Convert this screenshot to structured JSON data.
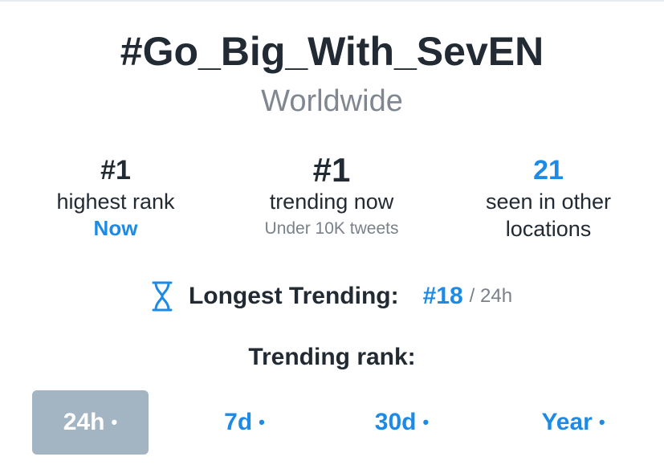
{
  "hashtag": "#Go_Big_With_SevEN",
  "location": "Worldwide",
  "stats": {
    "highest": {
      "value": "#1",
      "label": "highest rank",
      "sub": "Now"
    },
    "now": {
      "value": "#1",
      "label": "trending now",
      "sub": "Under 10K tweets"
    },
    "other": {
      "value": "21",
      "label1": "seen in other",
      "label2": "locations"
    }
  },
  "longest": {
    "label": "Longest Trending:",
    "rank": "#18",
    "period": "/ 24h",
    "icon": "hourglass-icon"
  },
  "trending_rank_label": "Trending rank:",
  "tabs": [
    {
      "label": "24h",
      "dot": "•",
      "active": true
    },
    {
      "label": "7d",
      "dot": "•"
    },
    {
      "label": "30d",
      "dot": "•"
    },
    {
      "label": "Year",
      "dot": "•"
    }
  ],
  "colors": {
    "accent": "#1d8ae6",
    "active_tab_bg": "#a3b4c3",
    "text": "#222a33",
    "muted": "#808790"
  }
}
